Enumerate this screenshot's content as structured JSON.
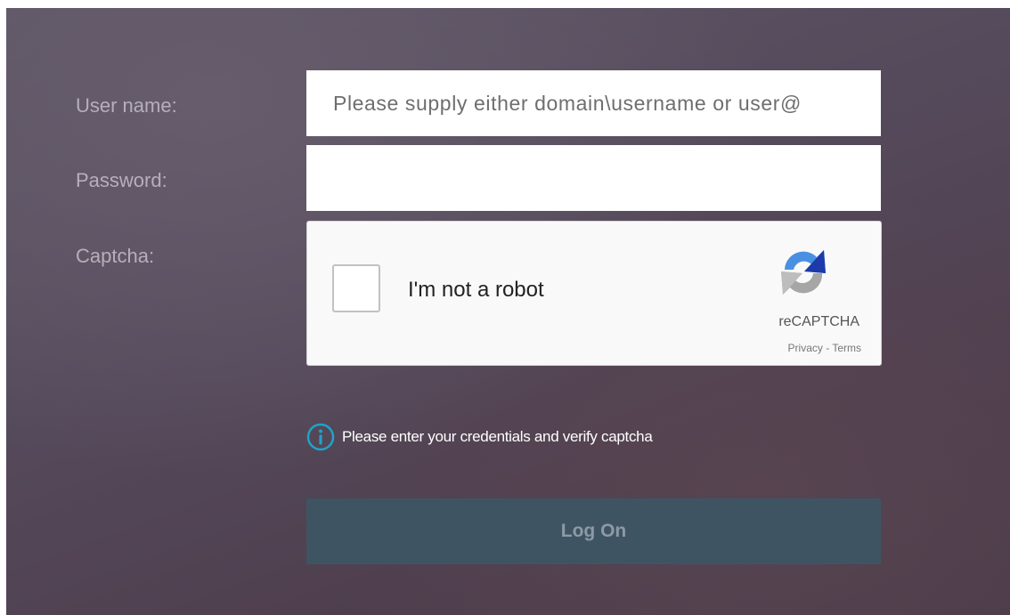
{
  "form": {
    "username_label": "User name:",
    "username_placeholder": "Please supply either domain\\username or user@",
    "username_value": "",
    "password_label": "Password:",
    "password_value": "",
    "captcha_label": "Captcha:"
  },
  "captcha": {
    "checkbox_text": "I'm not a robot",
    "brand": "reCAPTCHA",
    "privacy_link": "Privacy",
    "separator": " - ",
    "terms_link": "Terms",
    "icon": "recaptcha-logo-icon"
  },
  "info": {
    "icon": "info-icon",
    "message": "Please enter your credentials and verify captcha"
  },
  "actions": {
    "logon_label": "Log On"
  },
  "colors": {
    "info_icon": "#1fa3c8",
    "button_bg": "#3e5463",
    "button_text": "#8d9aa5",
    "label_text": "#b6afbb"
  }
}
